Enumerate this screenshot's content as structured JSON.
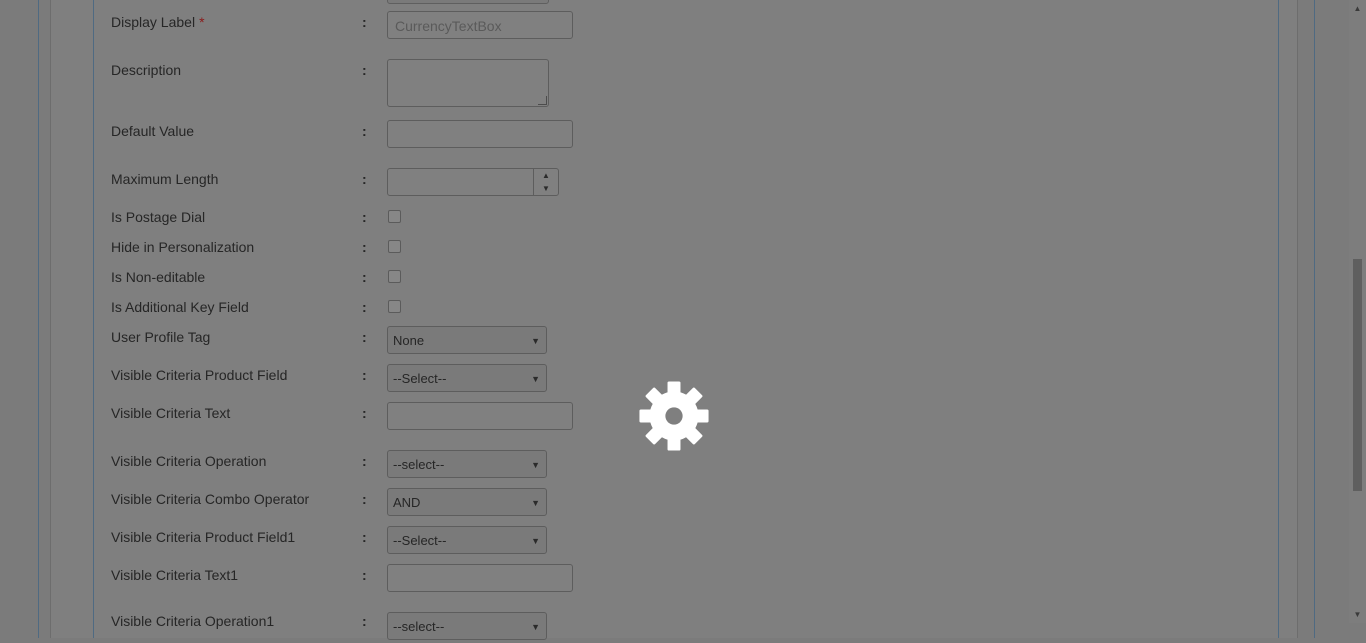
{
  "form": {
    "fields": [
      {
        "label": "Display Label",
        "required": "*",
        "type": "text",
        "value": "CurrencyTextBox"
      },
      {
        "label": "Description",
        "type": "textarea",
        "value": ""
      },
      {
        "label": "Default Value",
        "type": "text",
        "value": ""
      },
      {
        "label": "Maximum Length",
        "type": "spinner",
        "value": ""
      },
      {
        "label": "Is Postage Dial",
        "type": "checkbox",
        "checked": false
      },
      {
        "label": "Hide in Personalization",
        "type": "checkbox",
        "checked": false
      },
      {
        "label": "Is Non-editable",
        "type": "checkbox",
        "checked": false
      },
      {
        "label": "Is Additional Key Field",
        "type": "checkbox",
        "checked": false
      },
      {
        "label": "User Profile Tag",
        "type": "select",
        "value": "None"
      },
      {
        "label": "Visible Criteria Product Field",
        "type": "select",
        "value": "--Select--"
      },
      {
        "label": "Visible Criteria Text",
        "type": "text",
        "value": ""
      },
      {
        "label": "Visible Criteria Operation",
        "type": "select",
        "value": "--select--"
      },
      {
        "label": "Visible Criteria Combo Operator",
        "type": "select",
        "value": "AND"
      },
      {
        "label": "Visible Criteria Product Field1",
        "type": "select",
        "value": "--Select--"
      },
      {
        "label": "Visible Criteria Text1",
        "type": "text",
        "value": ""
      },
      {
        "label": "Visible Criteria Operation1",
        "type": "select",
        "value": "--select--"
      }
    ],
    "colon": ":"
  },
  "icons": {
    "loading": "gear-icon",
    "spin_up": "▲",
    "spin_down": "▼",
    "select_arrow": "▼",
    "scroll_up": "▲",
    "scroll_down": "▼"
  },
  "colors": {
    "overlay": "#7b7b7b",
    "panel_border": "#4f6a82",
    "required": "#8b1a1a",
    "gear": "#ffffff"
  }
}
